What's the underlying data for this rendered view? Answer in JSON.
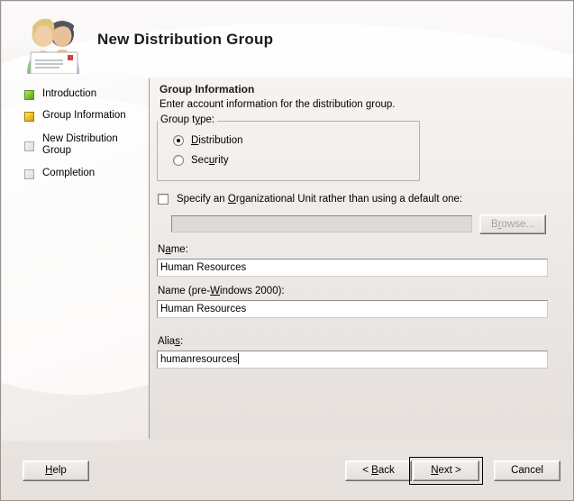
{
  "window": {
    "title": "New Distribution Group",
    "icon": "users-with-envelope-icon"
  },
  "sidebar": {
    "steps": [
      {
        "label": "Introduction",
        "state": "done"
      },
      {
        "label": "Group Information",
        "state": "current"
      },
      {
        "label": "New Distribution Group",
        "state": "pending"
      },
      {
        "label": "Completion",
        "state": "pending"
      }
    ]
  },
  "content": {
    "heading": "Group Information",
    "subheading": "Enter account information for the distribution group.",
    "group_type": {
      "legend": "Group type:",
      "options": [
        {
          "label": "Distribution",
          "selected": true
        },
        {
          "label": "Security",
          "selected": false
        }
      ]
    },
    "organizational_unit": {
      "checkbox_label": "Specify an Organizational Unit rather than using a default one:",
      "checked": false,
      "value": "",
      "browse_label": "Browse...",
      "enabled": false
    },
    "fields": [
      {
        "label": "Name:",
        "value": "Human Resources",
        "focused": false
      },
      {
        "label": "Name (pre-Windows 2000):",
        "value": "Human Resources",
        "focused": false
      },
      {
        "label": "Alias:",
        "value": "humanresources",
        "focused": true
      }
    ]
  },
  "buttons": {
    "help": "Help",
    "back": "< Back",
    "next": "Next >",
    "cancel": "Cancel",
    "default": "next"
  },
  "colors": {
    "step_done": "#78c42a",
    "step_current": "#f2c01d",
    "step_pending": "#dcdcdc",
    "divider": "#9b9a9f",
    "content_bg": "#ece7e4",
    "header_bg": "#fbf9f9"
  }
}
